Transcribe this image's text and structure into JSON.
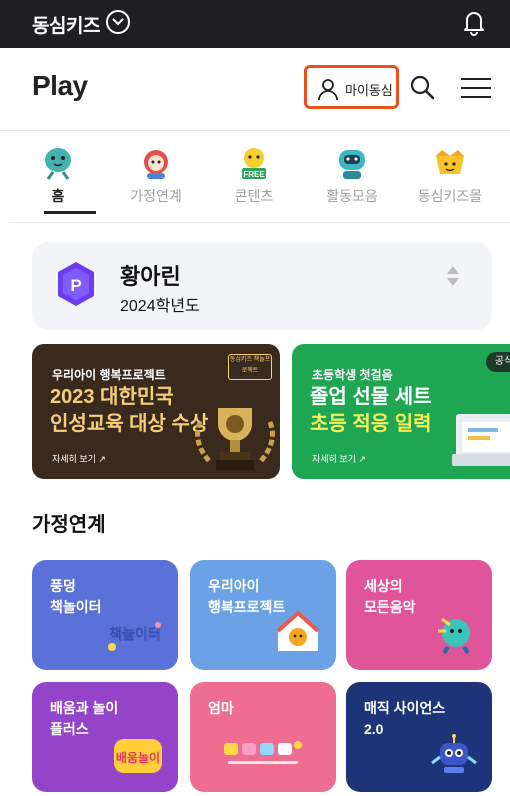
{
  "topbar": {
    "brand": "동심키즈",
    "chevron_icon": "chevron-down-icon",
    "bell_icon": "bell-icon"
  },
  "header": {
    "logo": "Play",
    "mypage_label": "마이동심",
    "search_icon": "search-icon",
    "menu_icon": "hamburger-menu-icon"
  },
  "tabs": [
    {
      "label": "홈",
      "active": true
    },
    {
      "label": "가정연계",
      "active": false
    },
    {
      "label": "콘텐츠",
      "active": false,
      "badge": "FREE"
    },
    {
      "label": "활동모음",
      "active": false
    },
    {
      "label": "동심키즈몰",
      "active": false
    }
  ],
  "class_card": {
    "icon_letter": "P",
    "name": "황아린",
    "year": "2024학년도"
  },
  "banners": [
    {
      "small": "우리아이 행복프로젝트",
      "line1": "2023 대한민국",
      "line2": "인성교육 대상 수상",
      "more": "자세히 보기 ↗",
      "tag": "동심키즈 책놀프로젝트"
    },
    {
      "small": "초등학생 첫걸음",
      "line1": "졸업 선물 세트",
      "line2": "초등 적응 일력",
      "more": "자세히 보기 ↗",
      "pill": "공식"
    }
  ],
  "section": {
    "title": "가정연계"
  },
  "cards": [
    {
      "title": "풍덩\n책놀이터",
      "art_text": "책놀이터"
    },
    {
      "title": "우리아이\n행복프로젝트"
    },
    {
      "title": "세상의\n모든음악"
    },
    {
      "title": "배움과 놀이\n플러스",
      "art_text": "배움놀이"
    },
    {
      "title": "엄마"
    },
    {
      "title": "매직 사이언스\n2.0"
    }
  ],
  "colors": {
    "topbar": "#1f1f23",
    "highlight": "#e8501d"
  }
}
